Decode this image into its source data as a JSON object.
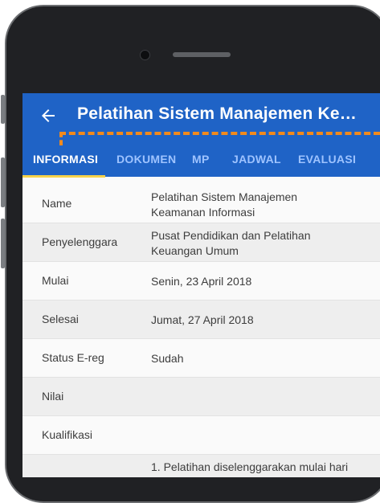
{
  "appbar": {
    "title": "Pelatihan Sistem Manajemen Ke…",
    "back_icon": "arrow-left-icon",
    "background": "#1f63c6"
  },
  "tabs": [
    {
      "label": "INFORMASI",
      "active": true
    },
    {
      "label": "DOKUMEN",
      "active": false
    },
    {
      "label": "MP",
      "active": false
    },
    {
      "label": "JADWAL",
      "active": false
    },
    {
      "label": "EVALUASI",
      "active": false
    }
  ],
  "accent": {
    "indicator": "#f7d24a",
    "annotation": "#f28a1d"
  },
  "info": [
    {
      "label": "Name",
      "value_line1": "Pelatihan Sistem Manajemen",
      "value_line2": "Keamanan Informasi"
    },
    {
      "label": "Penyelenggara",
      "value_line1": "Pusat Pendidikan dan Pelatihan",
      "value_line2": "Keuangan Umum"
    },
    {
      "label": "Mulai",
      "value_line1": "Senin, 23 April 2018",
      "value_line2": ""
    },
    {
      "label": "Selesai",
      "value_line1": "Jumat, 27 April 2018",
      "value_line2": ""
    },
    {
      "label": "Status E-reg",
      "value_line1": "Sudah",
      "value_line2": ""
    },
    {
      "label": "Nilai",
      "value_line1": "",
      "value_line2": ""
    },
    {
      "label": "Kualifikasi",
      "value_line1": "",
      "value_line2": ""
    },
    {
      "label": "",
      "value_line1": "1. Pelatihan diselenggarakan mulai hari",
      "value_line2": ""
    }
  ]
}
